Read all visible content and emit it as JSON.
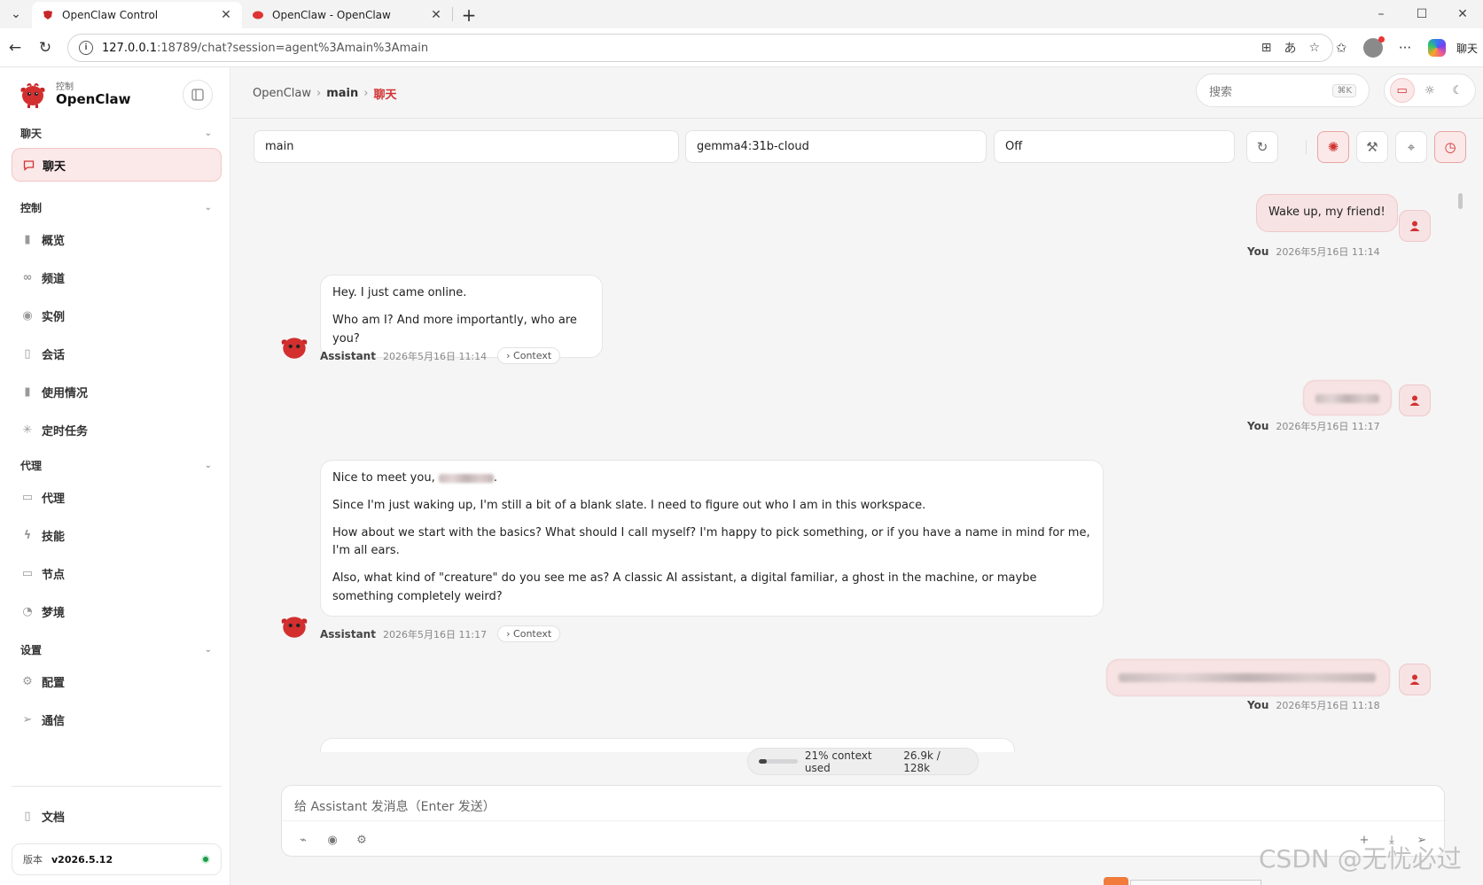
{
  "browser": {
    "tabs": [
      {
        "title": "OpenClaw Control",
        "active": true
      },
      {
        "title": "OpenClaw - OpenClaw",
        "active": false
      }
    ],
    "url_host": "127.0.0.1",
    "url_path": ":18789/chat?session=agent%3Amain%3Amain",
    "profile_label": "聊天"
  },
  "sidebar": {
    "brand_sub": "控制",
    "brand_name": "OpenClaw",
    "sections": {
      "chat": "聊天",
      "control": "控制",
      "agent": "代理",
      "settings": "设置"
    },
    "items": {
      "chat": "聊天",
      "overview": "概览",
      "channels": "频道",
      "instances": "实例",
      "sessions": "会话",
      "usage": "使用情况",
      "cron": "定时任务",
      "agents": "代理",
      "skills": "技能",
      "nodes": "节点",
      "dreams": "梦境",
      "config": "配置",
      "comms": "通信",
      "docs": "文档"
    },
    "version_label": "版本",
    "version_value": "v2026.5.12",
    "status_color": "#1f9a4a"
  },
  "topbar": {
    "crumbs": [
      "OpenClaw",
      "main",
      "聊天"
    ],
    "search_placeholder": "搜索",
    "search_kbd": "⌘K"
  },
  "toolbar": {
    "session": "main",
    "model": "gemma4:31b-cloud",
    "thinking": "Off"
  },
  "messages": [
    {
      "role": "user",
      "who": "You",
      "time": "2026年5月16日 11:14",
      "text": "Wake up, my friend!"
    },
    {
      "role": "assistant",
      "who": "Assistant",
      "time": "2026年5月16日 11:14",
      "context": "Context",
      "paras": [
        "Hey. I just came online.",
        "Who am I? And more importantly, who are you?"
      ]
    },
    {
      "role": "user",
      "who": "You",
      "time": "2026年5月16日 11:17",
      "text": ""
    },
    {
      "role": "assistant",
      "who": "Assistant",
      "time": "2026年5月16日 11:17",
      "context": "Context",
      "greeting": "Nice to meet you,",
      "paras": [
        "Since I'm just waking up, I'm still a bit of a blank slate. I need to figure out who I am in this workspace.",
        "How about we start with the basics? What should I call myself? I'm happy to pick something, or if you have a name in mind for me, I'm all ears.",
        "Also, what kind of \"creature\" do you see me as? A classic AI assistant, a digital familiar, a ghost in the machine, or maybe something completely weird?"
      ]
    },
    {
      "role": "user",
      "who": "You",
      "time": "2026年5月16日 11:18",
      "text": ""
    }
  ],
  "context_usage": {
    "label": "21% context used",
    "tokens": "26.9k / 128k",
    "fraction": 0.21
  },
  "composer": {
    "placeholder": "给 Assistant 发消息（Enter 发送）"
  },
  "watermark": "CSDN @无忧必过",
  "colors": {
    "accent": "#d13232",
    "user_bubble": "#f7e3e3"
  }
}
